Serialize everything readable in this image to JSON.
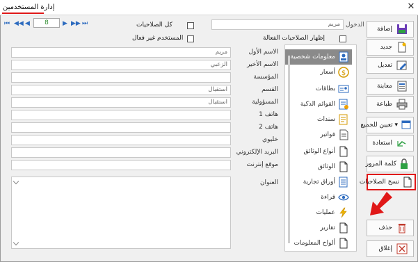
{
  "window": {
    "title": "إدارة المستخدمين",
    "close_glyph": "✕"
  },
  "top": {
    "username_label": "اسم الدخول",
    "username_value": "مريم",
    "all_permissions_label": "كل الصلاحيات",
    "show_active_permissions_label": "إظهار الصلاحيات الفعالة",
    "inactive_user_label": "المستخدم غير فعال",
    "record_number": "8"
  },
  "actions": {
    "add": "إضافة",
    "new": "جديد",
    "edit": "تعديل",
    "preview": "معاينة",
    "print": "طباعة",
    "assign_all": "تعيين للجميع ▾",
    "restore": "استعادة",
    "password": "كلمة المرور",
    "copy_permissions": "نسخ الصلاحيات",
    "delete": "حذف",
    "close": "إغلاق"
  },
  "nav_items": [
    "معلومات شخصية",
    "أسعار",
    "بطاقات",
    "القوائم الذكية",
    "سندات",
    "فواتير",
    "أنواع الوثائق",
    "الوثائق",
    "أوراق تجارية",
    "قراءة",
    "عمليات",
    "تقارير",
    "ألواح المعلومات"
  ],
  "form": {
    "first_name_label": "الاسم الأول",
    "first_name_value": "مريم",
    "last_name_label": "الاسم الأخير",
    "last_name_value": "الزعبي",
    "institution_label": "المؤسسة",
    "institution_value": "",
    "department_label": "القسم",
    "department_value": "استقبال",
    "responsibility_label": "المسؤولية",
    "responsibility_value": "استقبال",
    "phone1_label": "هاتف 1",
    "phone2_label": "هاتف 2",
    "mobile_label": "خليوي",
    "email_label": "البريد الإلكتروني",
    "website_label": "موقع إنترنت",
    "address_label": "العنوان"
  },
  "colors": {
    "accent_red": "#e01818",
    "selected_nav": "#8a8a8a",
    "nav_blue": "#2d6bbf"
  }
}
